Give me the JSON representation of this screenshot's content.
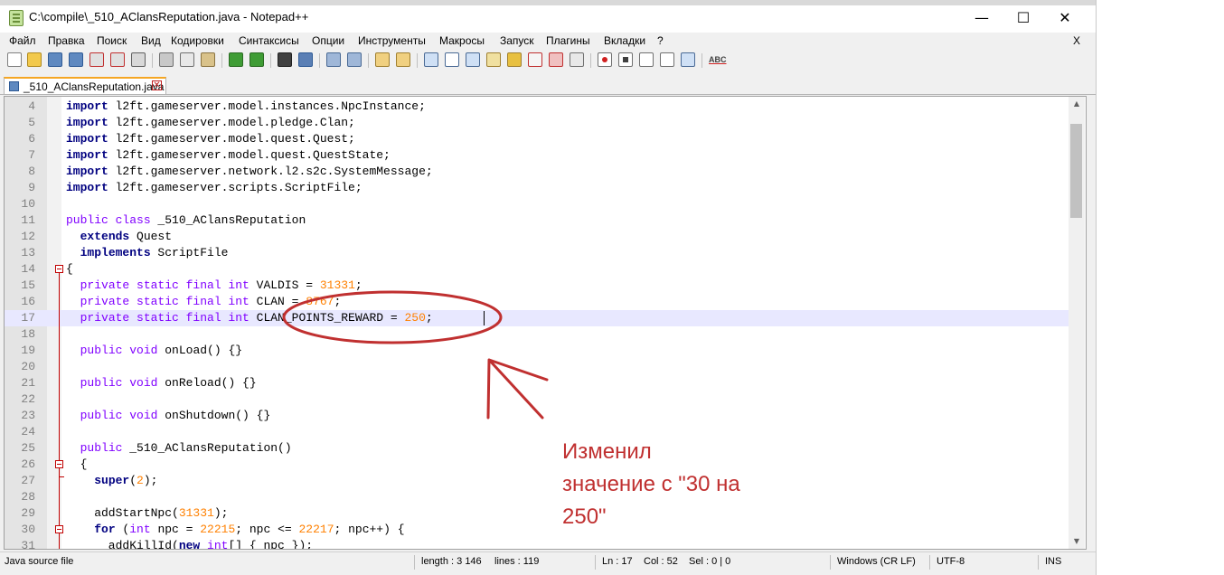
{
  "window": {
    "title": "C:\\compile\\_510_AClansReputation.java - Notepad++",
    "minimize_glyph": "—",
    "maximize_glyph": "☐",
    "close_glyph": "✕"
  },
  "menu": {
    "items": [
      "Файл",
      "Правка",
      "Поиск",
      "Вид",
      "Кодировки",
      "Синтаксисы",
      "Опции",
      "Инструменты",
      "Макросы",
      "Запуск",
      "Плагины",
      "Вкладки",
      "?"
    ],
    "close_glyph": "X"
  },
  "toolbar": {
    "icons": [
      "new-file-icon",
      "open-file-icon",
      "save-icon",
      "save-all-icon",
      "close-icon",
      "close-all-icon",
      "print-icon",
      "cut-icon",
      "copy-icon",
      "paste-icon",
      "undo-icon",
      "redo-icon",
      "find-icon",
      "replace-icon",
      "zoom-in-icon",
      "zoom-out-icon",
      "sync-vertical-icon",
      "sync-horizontal-icon",
      "word-wrap-icon",
      "show-all-chars-icon",
      "indent-guide-icon",
      "doc-map-icon",
      "function-list-icon",
      "folder-workspace-icon",
      "monitoring-icon",
      "record-macro-icon",
      "stop-record-icon",
      "play-macro-icon",
      "run-macro-multiple-icon",
      "save-macro-icon",
      "spell-check-icon"
    ],
    "spell_label": "ABC"
  },
  "tab": {
    "label": "_510_AClansReputation.java",
    "close_glyph": "✕"
  },
  "editor": {
    "current_line": 17,
    "lines": [
      {
        "n": "4",
        "t": [
          [
            "kw",
            "import"
          ],
          [
            "p",
            " l2ft.gameserver.model.instances.NpcInstance;"
          ]
        ]
      },
      {
        "n": "5",
        "t": [
          [
            "kw",
            "import"
          ],
          [
            "p",
            " l2ft.gameserver.model.pledge.Clan;"
          ]
        ]
      },
      {
        "n": "6",
        "t": [
          [
            "kw",
            "import"
          ],
          [
            "p",
            " l2ft.gameserver.model.quest.Quest;"
          ]
        ]
      },
      {
        "n": "7",
        "t": [
          [
            "kw",
            "import"
          ],
          [
            "p",
            " l2ft.gameserver.model.quest.QuestState;"
          ]
        ]
      },
      {
        "n": "8",
        "t": [
          [
            "kw",
            "import"
          ],
          [
            "p",
            " l2ft.gameserver.network.l2.s2c.SystemMessage;"
          ]
        ]
      },
      {
        "n": "9",
        "t": [
          [
            "kw",
            "import"
          ],
          [
            "p",
            " l2ft.gameserver.scripts.ScriptFile;"
          ]
        ]
      },
      {
        "n": "10",
        "t": []
      },
      {
        "n": "11",
        "t": [
          [
            "ty",
            "public class"
          ],
          [
            "p",
            " _510_AClansReputation"
          ]
        ]
      },
      {
        "n": "12",
        "t": [
          [
            "p",
            "  "
          ],
          [
            "kw",
            "extends"
          ],
          [
            "p",
            " Quest"
          ]
        ]
      },
      {
        "n": "13",
        "t": [
          [
            "p",
            "  "
          ],
          [
            "kw",
            "implements"
          ],
          [
            "p",
            " ScriptFile"
          ]
        ]
      },
      {
        "n": "14",
        "t": [
          [
            "p",
            "{"
          ]
        ]
      },
      {
        "n": "15",
        "t": [
          [
            "p",
            "  "
          ],
          [
            "ty",
            "private static final int"
          ],
          [
            "p",
            " VALDIS = "
          ],
          [
            "nu",
            "31331"
          ],
          [
            "p",
            ";"
          ]
        ]
      },
      {
        "n": "16",
        "t": [
          [
            "p",
            "  "
          ],
          [
            "ty",
            "private static final int"
          ],
          [
            "p",
            " CLAN = "
          ],
          [
            "nu",
            "8767"
          ],
          [
            "p",
            ";"
          ]
        ]
      },
      {
        "n": "17",
        "t": [
          [
            "p",
            "  "
          ],
          [
            "ty",
            "private static final int"
          ],
          [
            "p",
            " CLAN_POINTS_REWARD = "
          ],
          [
            "nu",
            "250"
          ],
          [
            "p",
            ";"
          ]
        ]
      },
      {
        "n": "18",
        "t": []
      },
      {
        "n": "19",
        "t": [
          [
            "p",
            "  "
          ],
          [
            "ty",
            "public void"
          ],
          [
            "p",
            " onLoad() {}"
          ]
        ]
      },
      {
        "n": "20",
        "t": []
      },
      {
        "n": "21",
        "t": [
          [
            "p",
            "  "
          ],
          [
            "ty",
            "public void"
          ],
          [
            "p",
            " onReload() {}"
          ]
        ]
      },
      {
        "n": "22",
        "t": []
      },
      {
        "n": "23",
        "t": [
          [
            "p",
            "  "
          ],
          [
            "ty",
            "public void"
          ],
          [
            "p",
            " onShutdown() {}"
          ]
        ]
      },
      {
        "n": "24",
        "t": []
      },
      {
        "n": "25",
        "t": [
          [
            "p",
            "  "
          ],
          [
            "ty",
            "public"
          ],
          [
            "p",
            " _510_AClansReputation()"
          ]
        ]
      },
      {
        "n": "26",
        "t": [
          [
            "p",
            "  {"
          ]
        ]
      },
      {
        "n": "27",
        "t": [
          [
            "p",
            "    "
          ],
          [
            "kw",
            "super"
          ],
          [
            "p",
            "("
          ],
          [
            "nu",
            "2"
          ],
          [
            "p",
            ");"
          ]
        ]
      },
      {
        "n": "28",
        "t": []
      },
      {
        "n": "29",
        "t": [
          [
            "p",
            "    addStartNpc("
          ],
          [
            "nu",
            "31331"
          ],
          [
            "p",
            ");"
          ]
        ]
      },
      {
        "n": "30",
        "t": [
          [
            "p",
            "    "
          ],
          [
            "kw",
            "for"
          ],
          [
            "p",
            " ("
          ],
          [
            "ty",
            "int"
          ],
          [
            "p",
            " npc = "
          ],
          [
            "nu",
            "22215"
          ],
          [
            "p",
            "; npc <= "
          ],
          [
            "nu",
            "22217"
          ],
          [
            "p",
            "; npc++) {"
          ]
        ]
      },
      {
        "n": "31",
        "t": [
          [
            "p",
            "      addKillId("
          ],
          [
            "kw",
            "new"
          ],
          [
            "p",
            " "
          ],
          [
            "ty",
            "int"
          ],
          [
            "p",
            "[] { npc });"
          ]
        ]
      }
    ]
  },
  "status": {
    "file_type": "Java source file",
    "length": "length : 3 146",
    "lines": "lines : 119",
    "ln": "Ln : 17",
    "col": "Col : 52",
    "sel": "Sel : 0 | 0",
    "eol": "Windows (CR LF)",
    "encoding": "UTF-8",
    "mode": "INS"
  },
  "annotation": {
    "text_lines": [
      "Изменил",
      "значение с \"30 на",
      "250\""
    ],
    "color": "#c03030"
  }
}
